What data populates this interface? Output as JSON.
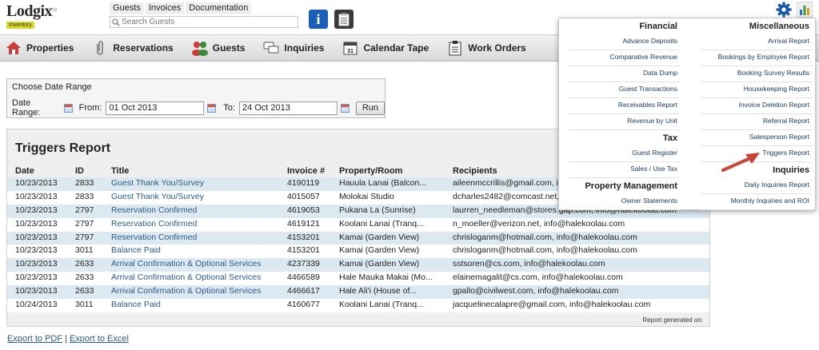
{
  "app": {
    "logo_text": "Lodgix",
    "logo_sub": "Inventory",
    "logo_tm": "TM"
  },
  "top_links": [
    "Guests",
    "Invoices",
    "Documentation"
  ],
  "search": {
    "placeholder": "Search Guests"
  },
  "nav": [
    {
      "label": "Properties",
      "icon": "house-icon"
    },
    {
      "label": "Reservations",
      "icon": "paperclip-icon"
    },
    {
      "label": "Guests",
      "icon": "people-icon"
    },
    {
      "label": "Inquiries",
      "icon": "chat-icon"
    },
    {
      "label": "Calendar Tape",
      "icon": "calendar-icon"
    },
    {
      "label": "Work Orders",
      "icon": "clipboard-icon"
    }
  ],
  "date_range": {
    "title": "Choose Date Range",
    "label": "Date Range:",
    "from_label": "From:",
    "from_value": "01 Oct 2013",
    "to_label": "To:",
    "to_value": "24 Oct 2013",
    "run_label": "Run"
  },
  "report": {
    "title": "Triggers Report",
    "columns": [
      "Date",
      "ID",
      "Title",
      "Invoice #",
      "Property/Room",
      "Recipients"
    ],
    "rows": [
      {
        "date": "10/23/2013",
        "id": "2833",
        "title": "Guest Thank You/Survey",
        "invoice": "4190119",
        "property": "Hauula Lanai (Balcon...",
        "recipients": "aileenmccrillis@gmail.com, info@halekoolau.com"
      },
      {
        "date": "10/23/2013",
        "id": "2833",
        "title": "Guest Thank You/Survey",
        "invoice": "4015057",
        "property": "Molokai Studio",
        "recipients": "dcharles2482@comcast.net, info@halekoolau.com"
      },
      {
        "date": "10/23/2013",
        "id": "2797",
        "title": "Reservation Confirmed",
        "invoice": "4619053",
        "property": "Pukana La (Sunrise)",
        "recipients": "laurren_needleman@stores.gap.com, info@halekoolau.com"
      },
      {
        "date": "10/23/2013",
        "id": "2797",
        "title": "Reservation Confirmed",
        "invoice": "4619121",
        "property": "Koolani Lanai (Tranq...",
        "recipients": "n_moeller@verizon.net, info@halekoolau.com"
      },
      {
        "date": "10/23/2013",
        "id": "2797",
        "title": "Reservation Confirmed",
        "invoice": "4153201",
        "property": "Kamai (Garden View)",
        "recipients": "chrisloganm@hotmail.com, info@halekoolau.com"
      },
      {
        "date": "10/23/2013",
        "id": "3011",
        "title": "Balance Paid",
        "invoice": "4153201",
        "property": "Kamai (Garden View)",
        "recipients": "chrisloganm@hotmail.com, info@halekoolau.com"
      },
      {
        "date": "10/23/2013",
        "id": "2633",
        "title": "Arrival Confirmation & Optional Services",
        "invoice": "4237339",
        "property": "Kamai (Garden View)",
        "recipients": "sstsoren@cs.com, info@halekoolau.com"
      },
      {
        "date": "10/23/2013",
        "id": "2633",
        "title": "Arrival Confirmation & Optional Services",
        "invoice": "4466589",
        "property": "Hale Mauka Makai (Mo...",
        "recipients": "elainemagalit@cs.com, info@halekoolau.com"
      },
      {
        "date": "10/23/2013",
        "id": "2633",
        "title": "Arrival Confirmation & Optional Services",
        "invoice": "4466617",
        "property": "Hale Ali'i (House of...",
        "recipients": "gpallo@civilwest.com, info@halekoolau.com"
      },
      {
        "date": "10/24/2013",
        "id": "3011",
        "title": "Balance Paid",
        "invoice": "4160677",
        "property": "Koolani Lanai (Tranq...",
        "recipients": "jacquelinecalapre@gmail.com, info@halekoolau.com"
      }
    ],
    "footer": "Report generated on:"
  },
  "export": {
    "pdf_label": "Export to PDF",
    "separator": "|",
    "excel_label": "Export to Excel"
  },
  "reports_menu": {
    "left": [
      {
        "heading": "Financial",
        "items": [
          "Advance Deposits",
          "Comparative Revenue",
          "Data Dump",
          "Guest Transactions",
          "Receivables Report",
          "Revenue by Unit"
        ]
      },
      {
        "heading": "Tax",
        "items": [
          "Guest Register",
          "Sales / Use Tax"
        ]
      },
      {
        "heading": "Property Management",
        "items": [
          "Owner Statements"
        ]
      }
    ],
    "right": [
      {
        "heading": "Miscellaneous",
        "items": [
          "Arrival Report",
          "Bookings by Employee Report",
          "Booking Survey Results",
          "Housekeeping Report",
          "Invoice Deletion Report",
          "Referral Report",
          "Salesperson Report",
          "Triggers Report"
        ]
      },
      {
        "heading": "Inquiries",
        "items": [
          "Daily Inquiries Report",
          "Monthly Inquiries and ROI"
        ]
      }
    ]
  },
  "colors": {
    "accent_link": "#2a5a8a",
    "row_alt": "#dce9f1",
    "arrow": "#c8453a",
    "info_blue": "#1a5fb4"
  }
}
